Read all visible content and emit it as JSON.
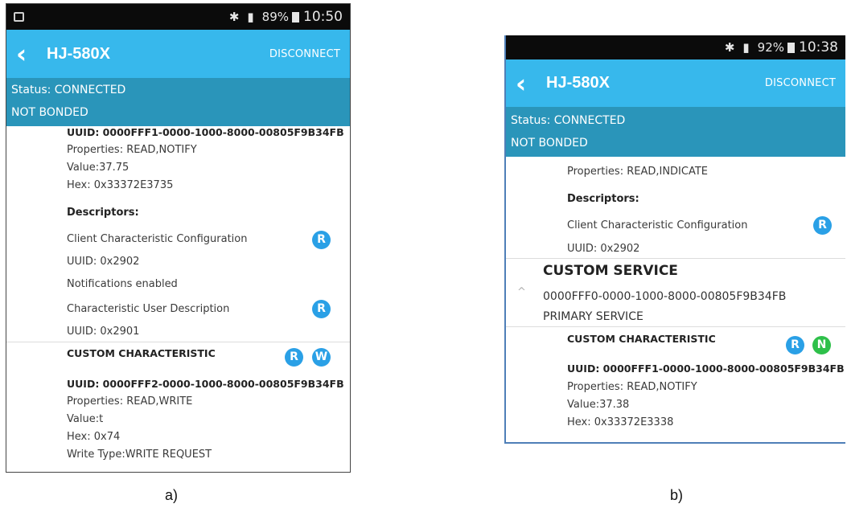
{
  "phone_a": {
    "statusbar": {
      "bluetooth_icon": "✱",
      "signal_icon": "▮",
      "battery": "89%",
      "time": "10:50"
    },
    "appbar": {
      "back_icon": "‹",
      "title": "HJ-580X",
      "disconnect": "DISCONNECT"
    },
    "status": {
      "connection": "Status: CONNECTED",
      "bond": "NOT BONDED"
    },
    "lines": {
      "uuid1": "UUID: 0000FFF1-0000-1000-8000-00805F9B34FB",
      "props1": "Properties: READ,NOTIFY",
      "value1": "Value:37.75",
      "hex1": "Hex: 0x33372E3735",
      "descriptors": "Descriptors:",
      "cccd": "Client Characteristic Configuration",
      "cccd_uuid": "UUID: 0x2902",
      "notif": "Notifications enabled",
      "cud": "Characteristic User Description",
      "cud_uuid": "UUID: 0x2901",
      "custom_char": "CUSTOM CHARACTERISTIC",
      "uuid2": "UUID: 0000FFF2-0000-1000-8000-00805F9B34FB",
      "props2": "Properties: READ,WRITE",
      "value2": "Value:t",
      "hex2": "Hex: 0x74",
      "write_type": "Write Type:WRITE REQUEST"
    },
    "badges": {
      "read": "R",
      "write": "W"
    },
    "caption": "a)"
  },
  "phone_b": {
    "statusbar": {
      "bluetooth_icon": "✱",
      "signal_icon": "▮",
      "battery": "92%",
      "time": "10:38"
    },
    "appbar": {
      "back_icon": "‹",
      "title": "HJ-580X",
      "disconnect": "DISCONNECT"
    },
    "status": {
      "connection": "Status: CONNECTED",
      "bond": "NOT BONDED"
    },
    "lines": {
      "props0": "Properties: READ,INDICATE",
      "descriptors": "Descriptors:",
      "cccd": "Client Characteristic Configuration",
      "cccd_uuid": "UUID: 0x2902",
      "custom_service": "CUSTOM SERVICE",
      "service_uuid": "0000FFF0-0000-1000-8000-00805F9B34FB",
      "primary": "PRIMARY SERVICE",
      "custom_char": "CUSTOM CHARACTERISTIC",
      "uuid1": "UUID: 0000FFF1-0000-1000-8000-00805F9B34FB",
      "props1": "Properties: READ,NOTIFY",
      "value1": "Value:37.38",
      "hex1": "Hex: 0x33372E3338"
    },
    "badges": {
      "read": "R",
      "notify": "N"
    },
    "caret": "^",
    "caption": "b)"
  },
  "colors": {
    "appbar": "#37b8ec",
    "status": "#2a95ba",
    "badge_blue": "#2aa0e6",
    "badge_green": "#2ec04a"
  }
}
